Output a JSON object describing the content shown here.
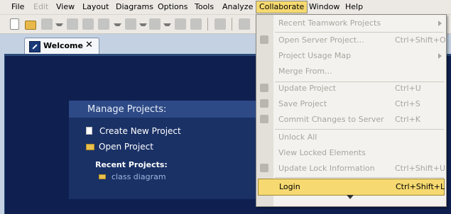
{
  "menubar": {
    "items": [
      {
        "label": "File",
        "state": "normal"
      },
      {
        "label": "Edit",
        "state": "disabled"
      },
      {
        "label": "View",
        "state": "normal"
      },
      {
        "label": "Layout",
        "state": "normal"
      },
      {
        "label": "Diagrams",
        "state": "normal"
      },
      {
        "label": "Options",
        "state": "normal"
      },
      {
        "label": "Tools",
        "state": "normal"
      },
      {
        "label": "Analyze",
        "state": "normal"
      },
      {
        "label": "Collaborate",
        "state": "active"
      },
      {
        "label": "Window",
        "state": "normal"
      },
      {
        "label": "Help",
        "state": "normal"
      }
    ]
  },
  "toolbar": {
    "icons": [
      "new-document-icon",
      "open-folder-icon",
      "save-icon",
      "print-icon",
      "undo-icon",
      "redo-icon",
      "validate-icon"
    ]
  },
  "tabs": {
    "welcome_label": "Welcome",
    "close_glyph": "✕"
  },
  "welcome": {
    "panel_title": "Manage Projects:",
    "create_label": "Create New Project",
    "open_label": "Open Project",
    "recent_heading": "Recent Projects:",
    "recent_items": [
      "class diagram"
    ]
  },
  "collaborate_menu": {
    "items": [
      {
        "label": "Recent Teamwork Projects",
        "shortcut": "",
        "submenu": true,
        "enabled": false
      },
      {
        "label": "Open Server Project...",
        "shortcut": "Ctrl+Shift+O",
        "submenu": false,
        "enabled": false
      },
      {
        "label": "Project Usage Map",
        "shortcut": "",
        "submenu": true,
        "enabled": false
      },
      {
        "label": "Merge From...",
        "shortcut": "",
        "submenu": false,
        "enabled": false
      },
      {
        "label": "Update Project",
        "shortcut": "Ctrl+U",
        "submenu": false,
        "enabled": false
      },
      {
        "label": "Save Project",
        "shortcut": "Ctrl+S",
        "submenu": false,
        "enabled": false
      },
      {
        "label": "Commit Changes to Server",
        "shortcut": "Ctrl+K",
        "submenu": false,
        "enabled": false
      },
      {
        "label": "Unlock All",
        "shortcut": "",
        "submenu": false,
        "enabled": false
      },
      {
        "label": "View Locked Elements",
        "shortcut": "",
        "submenu": false,
        "enabled": false
      },
      {
        "label": "Update Lock Information",
        "shortcut": "Ctrl+Shift+U",
        "submenu": false,
        "enabled": false
      },
      {
        "label": "Login",
        "shortcut": "Ctrl+Shift+L",
        "submenu": false,
        "enabled": true,
        "highlighted": true
      }
    ]
  },
  "colors": {
    "menu_highlight": "#f6d970",
    "welcome_background": "#0f2050",
    "panel_header": "#2d4a86"
  }
}
